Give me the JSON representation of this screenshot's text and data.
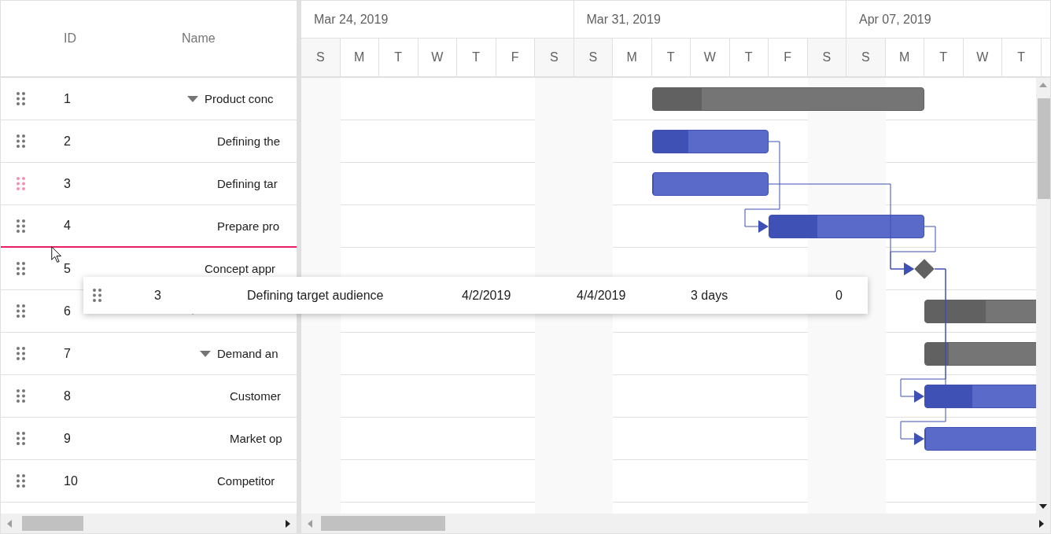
{
  "grid": {
    "columns": [
      {
        "label": "ID"
      },
      {
        "label": "Name"
      }
    ]
  },
  "timeline": {
    "weeks": [
      {
        "label": "Mar 24, 2019",
        "days": [
          "S",
          "M",
          "T",
          "W",
          "T",
          "F",
          "S"
        ]
      },
      {
        "label": "Mar 31, 2019",
        "days": [
          "S",
          "M",
          "T",
          "W",
          "T",
          "F",
          "S"
        ]
      },
      {
        "label": "Apr 07, 2019",
        "days": [
          "S",
          "M",
          "T",
          "W",
          "T"
        ]
      }
    ]
  },
  "tasks": [
    {
      "number": "1",
      "name": "Product conc",
      "kind": "summary",
      "expanded": true,
      "level": 0.18,
      "dragging": false,
      "drop_below": false,
      "children": [
        {
          "number": "2",
          "name": "Defining the",
          "kind": "task",
          "level": 0.31,
          "dragging": false,
          "drop_below": false
        },
        {
          "number": "3",
          "name": "Defining tar",
          "kind": "task",
          "level": 0,
          "dragging": true,
          "drop_below": false
        },
        {
          "number": "4",
          "name": "Prepare pro",
          "kind": "task",
          "level": 0.31,
          "dragging": false,
          "drop_below": true
        }
      ]
    },
    {
      "number": "5",
      "name": "Concept appr",
      "kind": "milestone",
      "dragging": false,
      "drop_below": false
    },
    {
      "number": "6",
      "kind": "summary",
      "expanded": true,
      "level": 0.26,
      "dragging": false,
      "drop_below": false,
      "children": [
        {
          "number": "7",
          "name": "Demand an",
          "kind": "summary",
          "expanded": true,
          "level": 0.1,
          "dragging": false,
          "drop_below": false,
          "children": [
            {
              "number": "8",
              "name": "Customer",
              "kind": "task",
              "level": 0.41,
              "dragging": false,
              "drop_below": false
            },
            {
              "number": "9",
              "name": "Market op",
              "kind": "task",
              "level": 0,
              "dragging": false,
              "drop_below": false
            }
          ]
        },
        {
          "number": "10",
          "name": "Competitor",
          "dragging": false,
          "drop_below": false
        }
      ]
    }
  ],
  "drag_preview": {
    "number": "3",
    "name": "Defining target audience",
    "start": "4/2/2019",
    "end": "4/4/2019",
    "duration": "3 days",
    "progress": "0"
  }
}
